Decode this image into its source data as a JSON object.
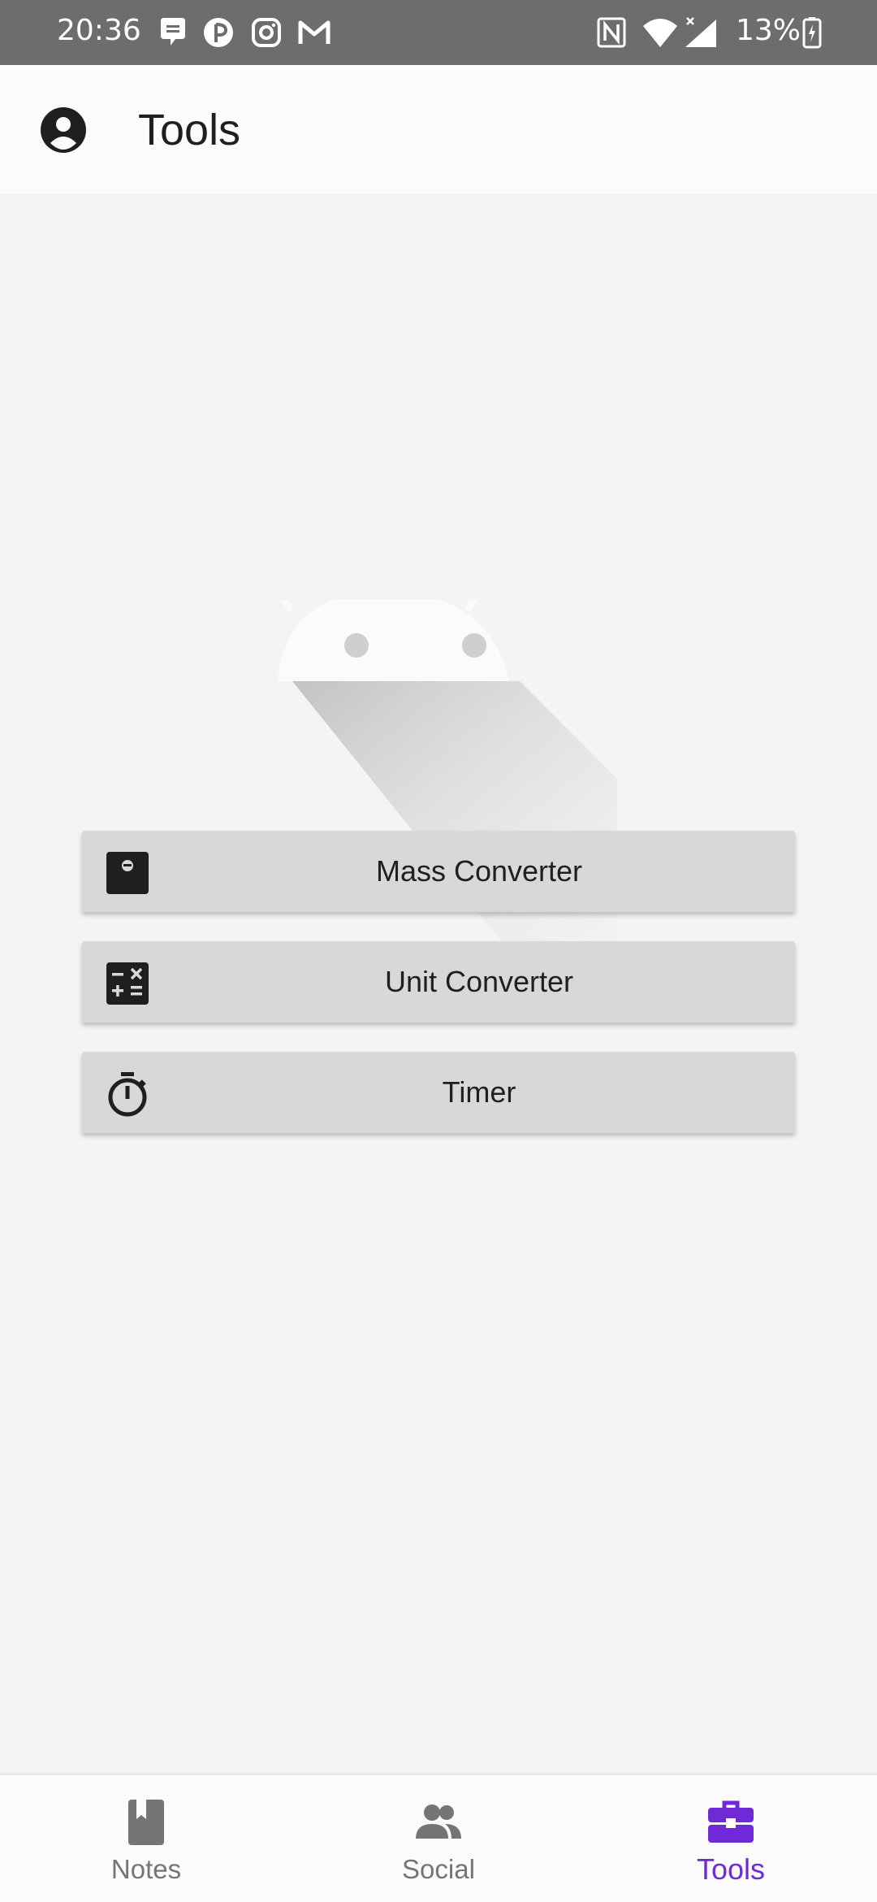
{
  "status_bar": {
    "time": "20:36",
    "battery": "13%",
    "left_icons": [
      "chat-bubble-icon",
      "pinterest-icon",
      "instagram-icon",
      "gmail-icon"
    ],
    "right_icons": [
      "nfc-icon",
      "wifi-icon",
      "cellular-signal-icon",
      "battery-icon"
    ]
  },
  "app_bar": {
    "title": "Tools",
    "account_icon": "account-circle-icon"
  },
  "tools": [
    {
      "label": "Mass Converter",
      "icon": "scale-icon"
    },
    {
      "label": "Unit Converter",
      "icon": "calculator-icon"
    },
    {
      "label": "Timer",
      "icon": "stopwatch-icon"
    }
  ],
  "bottom_nav": {
    "items": [
      {
        "label": "Notes",
        "icon": "notebook-icon",
        "active": false
      },
      {
        "label": "Social",
        "icon": "people-icon",
        "active": false
      },
      {
        "label": "Tools",
        "icon": "toolbox-icon",
        "active": true
      }
    ]
  },
  "colors": {
    "status_bar": "#6d6d6d",
    "accent": "#6f29d6",
    "button": "#d8d8d8",
    "background": "#f4f4f4"
  }
}
